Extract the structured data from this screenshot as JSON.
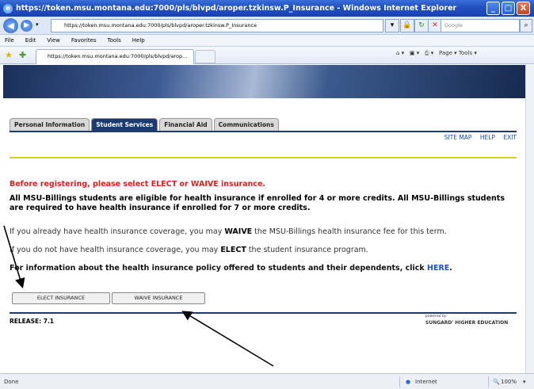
{
  "window": {
    "title": "https://token.msu.montana.edu:7000/pls/blvpd/aroper.tzkinsw.P_Insurance - Windows Internet Explorer",
    "controls": {
      "minimize": "_",
      "maximize": "□",
      "close": "X"
    }
  },
  "addressbar": {
    "url": "https://token.msu.montana.edu:7000/pls/blvpd/aroper.tzkinsw.P_Insurance",
    "search_placeholder": "Google"
  },
  "menu": [
    "File",
    "Edit",
    "View",
    "Favorites",
    "Tools",
    "Help"
  ],
  "favorites": {
    "tab_title": "https://token.msu.montana.edu:7000/pls/blvpd/arop...",
    "commands": "Page ▾   Tools ▾"
  },
  "page": {
    "tabs": [
      "Personal Information",
      "Student Services",
      "Financial Aid",
      "Communications"
    ],
    "active_tab": "Student Services",
    "links": [
      "SITE MAP",
      "HELP",
      "EXIT"
    ],
    "warning": "Before registering, please select ELECT or WAIVE insurance.",
    "eligibility": "All MSU-Billings students are eligible for health insurance if enrolled for 4 or more credits. All MSU-Billings students are required to have health insurance if enrolled for 7 or more credits.",
    "waive_pre": "If you already have health insurance coverage, you may ",
    "waive_word": "WAIVE",
    "waive_post": " the MSU-Billings health insurance fee for this term.",
    "elect_pre": "If you do not have health insurance coverage, you may ",
    "elect_word": "ELECT",
    "elect_post": " the student insurance program.",
    "info_pre": "For information about the health insurance policy offered to students and their dependents, click ",
    "info_link": "HERE",
    "info_post": ".",
    "elect_button": "ELECT INSURANCE",
    "waive_button": "WAIVE INSURANCE",
    "release": "RELEASE: 7.1",
    "powered_by": "powered by",
    "vendor": "SUNGARD' HIGHER EDUCATION"
  },
  "statusbar": {
    "left": "Done",
    "zone": "Internet",
    "zoom": "100%"
  },
  "colors": {
    "titlebar": "#1f4fc0",
    "tab_active": "#1c3b70",
    "warning": "#e02020",
    "link": "#1c4fd0",
    "divider_yellow": "#d7cf2a"
  }
}
